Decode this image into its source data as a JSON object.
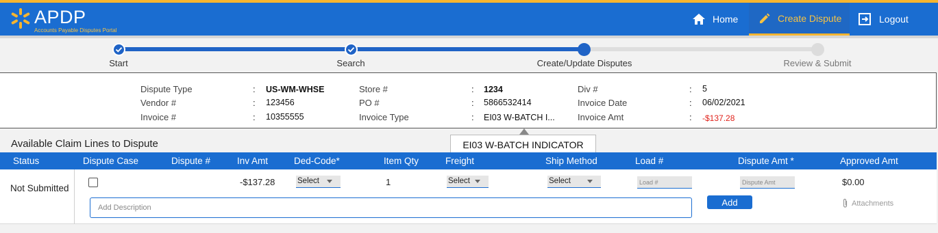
{
  "header": {
    "title": "APDP",
    "subtitle": "Accounts Payable Disputes Portal",
    "nav": [
      {
        "label": "Home",
        "icon": "home-icon"
      },
      {
        "label": "Create Dispute",
        "icon": "pencil-icon",
        "active": true
      },
      {
        "label": "Logout",
        "icon": "logout-icon"
      }
    ],
    "colors": {
      "brand": "#1a6dd1",
      "accent": "#f6b530"
    }
  },
  "stepper": {
    "steps": [
      {
        "label": "Start",
        "state": "done"
      },
      {
        "label": "Search",
        "state": "done"
      },
      {
        "label": "Create/Update Disputes",
        "state": "current"
      },
      {
        "label": "Review & Submit",
        "state": "todo"
      }
    ]
  },
  "info": {
    "dispute_type": {
      "label": "Dispute Type",
      "value": "US-WM-WHSE"
    },
    "vendor": {
      "label": "Vendor #",
      "value": "123456"
    },
    "invoice": {
      "label": "Invoice #",
      "value": "10355555"
    },
    "store": {
      "label": "Store #",
      "value": "1234"
    },
    "po": {
      "label": "PO #",
      "value": "5866532414"
    },
    "invoice_type": {
      "label": "Invoice Type",
      "value": "EI03 W-BATCH I..."
    },
    "div": {
      "label": "Div #",
      "value": "5"
    },
    "invoice_date": {
      "label": "Invoice Date",
      "value": "06/02/2021"
    },
    "invoice_amt": {
      "label": "Invoice Amt",
      "value": "-$137.28"
    },
    "colon": ":"
  },
  "tooltip": {
    "text": "EI03 W-BATCH INDICATOR"
  },
  "section": {
    "title": "Available Claim Lines to Dispute"
  },
  "table": {
    "headers": {
      "status": "Status",
      "dispute_case": "Dispute Case",
      "dispute_no": "Dispute #",
      "inv_amt": "Inv Amt",
      "ded_code": "Ded-Code*",
      "item_qty": "Item Qty",
      "freight": "Freight",
      "ship_method": "Ship Method",
      "load_no": "Load #",
      "dispute_amt": "Dispute Amt *",
      "approved_amt": "Approved Amt"
    },
    "row": {
      "status": "Not Submitted",
      "inv_amt": "-$137.28",
      "ded_code": "Select",
      "item_qty": "1",
      "freight": "Select",
      "ship_method": "Select",
      "load_placeholder": "Load #",
      "dispute_amt_placeholder": "Dispute Amt",
      "approved_amt": "$0.00",
      "desc_placeholder": "Add Description",
      "add_label": "Add",
      "attach_label": "Attachments"
    }
  }
}
